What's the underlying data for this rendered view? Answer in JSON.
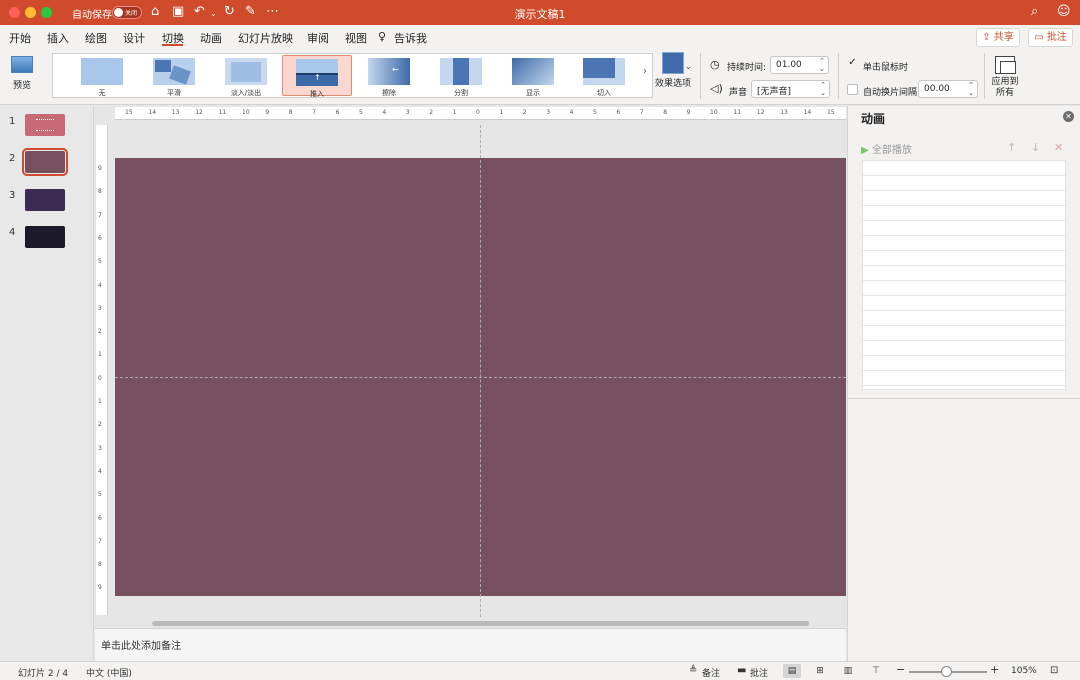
{
  "window": {
    "title": "演示文稿1",
    "autosave_label": "自动保存",
    "autosave_state": "关闭",
    "accent": "#cf4b2b"
  },
  "menu": {
    "items": [
      "开始",
      "插入",
      "绘图",
      "设计",
      "切换",
      "动画",
      "幻灯片放映",
      "审阅",
      "视图"
    ],
    "active": "切换",
    "tell_me": "告诉我",
    "share": "共享",
    "comments": "批注"
  },
  "ribbon": {
    "preview_label": "预览",
    "transitions": [
      "无",
      "平滑",
      "淡入/淡出",
      "推入",
      "擦除",
      "分割",
      "显示",
      "切入"
    ],
    "selected_transition": "推入",
    "effect_options_label": "效果选项",
    "duration_label": "持续时间:",
    "duration_value": "01.00",
    "sound_label": "声音",
    "sound_value": "[无声音]",
    "on_click_label": "单击鼠标时",
    "on_click_checked": true,
    "auto_advance_label": "自动换片间隔:",
    "auto_advance_value": "00.00",
    "auto_advance_checked": false,
    "apply_all_line1": "应用到",
    "apply_all_line2": "所有"
  },
  "slides": [
    {
      "number": "1",
      "color": "#c86a73"
    },
    {
      "number": "2",
      "color": "#77505f"
    },
    {
      "number": "3",
      "color": "#3b2a52"
    },
    {
      "number": "4",
      "color": "#1d1a2a"
    }
  ],
  "selected_slide": "2",
  "ruler": {
    "horizontal": [
      "15",
      "14",
      "13",
      "12",
      "11",
      "10",
      "9",
      "8",
      "7",
      "6",
      "5",
      "4",
      "3",
      "2",
      "1",
      "0",
      "1",
      "2",
      "3",
      "4",
      "5",
      "6",
      "7",
      "8",
      "9",
      "10",
      "11",
      "12",
      "13",
      "14",
      "15"
    ],
    "vertical": [
      "9",
      "8",
      "7",
      "6",
      "5",
      "4",
      "3",
      "2",
      "1",
      "0",
      "1",
      "2",
      "3",
      "4",
      "5",
      "6",
      "7",
      "8",
      "9"
    ]
  },
  "notes_placeholder": "单击此处添加备注",
  "animation_pane": {
    "title": "动画",
    "play_all": "全部播放"
  },
  "status": {
    "slide_info": "幻灯片 2 / 4",
    "language": "中文 (中国)",
    "notes": "备注",
    "comments": "批注",
    "zoom": "105%",
    "zoom_fraction": 0.5
  }
}
